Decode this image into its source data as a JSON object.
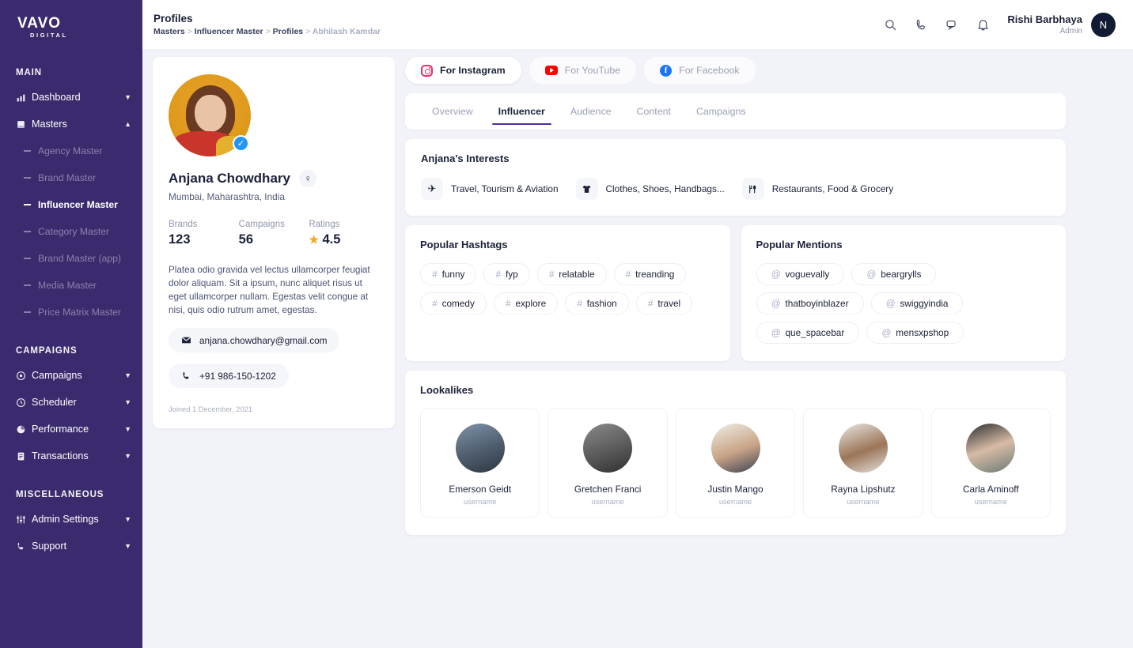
{
  "sidebar": {
    "logo": {
      "main": "VAVO",
      "sub": "DIGITAL"
    },
    "sections": [
      {
        "label": "MAIN",
        "items": [
          {
            "label": "Dashboard",
            "icon": "chart-bar-icon",
            "chevron": "chevron-down-icon"
          },
          {
            "label": "Masters",
            "icon": "book-icon",
            "chevron": "chevron-up-icon",
            "children": [
              {
                "label": "Agency Master",
                "active": false
              },
              {
                "label": "Brand Master",
                "active": false
              },
              {
                "label": "Influencer Master",
                "active": true
              },
              {
                "label": "Category Master",
                "active": false
              },
              {
                "label": "Brand Master (app)",
                "active": false
              },
              {
                "label": "Media Master",
                "active": false
              },
              {
                "label": "Price Matrix Master",
                "active": false
              }
            ]
          }
        ]
      },
      {
        "label": "CAMPAIGNS",
        "items": [
          {
            "label": "Campaigns",
            "icon": "target-icon",
            "chevron": "chevron-down-icon"
          },
          {
            "label": "Scheduler",
            "icon": "history-icon",
            "chevron": "chevron-down-icon"
          },
          {
            "label": "Performance",
            "icon": "pie-chart-icon",
            "chevron": "chevron-down-icon"
          },
          {
            "label": "Transactions",
            "icon": "receipt-icon",
            "chevron": "chevron-down-icon"
          }
        ]
      },
      {
        "label": "MISCELLANEOUS",
        "items": [
          {
            "label": "Admin Settings",
            "icon": "sliders-icon",
            "chevron": "chevron-down-icon"
          },
          {
            "label": "Support",
            "icon": "phone-icon",
            "chevron": "chevron-down-icon"
          }
        ]
      }
    ]
  },
  "topbar": {
    "title": "Profiles",
    "breadcrumb": [
      "Masters",
      "Influencer Master",
      "Profiles",
      "Abhilash Kamdar"
    ],
    "icons": [
      "search-icon",
      "phone-icon",
      "chat-icon",
      "bell-icon"
    ],
    "user": {
      "name": "Rishi Barbhaya",
      "role": "Admin",
      "initial": "N"
    }
  },
  "profile": {
    "name": "Anjana Chowdhary",
    "gender_symbol": "♀",
    "location": "Mumbai, Maharashtra, India",
    "verified": true,
    "stats": [
      {
        "label": "Brands",
        "value": "123"
      },
      {
        "label": "Campaigns",
        "value": "56"
      },
      {
        "label": "Ratings",
        "value": "4.5",
        "star": "★"
      }
    ],
    "bio": "Platea odio gravida vel lectus ullamcorper feugiat dolor aliquam. Sit a ipsum, nunc aliquet risus ut eget ullamcorper nullam. Egestas velit congue at nisi, quis odio rutrum amet, egestas.",
    "email": "anjana.chowdhary@gmail.com",
    "phone": "+91 986-150-1202",
    "joined": "Joined 1 December, 2021"
  },
  "platforms": [
    {
      "label": "For Instagram",
      "icon": "instagram-icon",
      "active": true
    },
    {
      "label": "For YouTube",
      "icon": "youtube-icon",
      "active": false
    },
    {
      "label": "For Facebook",
      "icon": "facebook-icon",
      "active": false
    }
  ],
  "tabs": [
    {
      "label": "Overview",
      "active": false
    },
    {
      "label": "Influencer",
      "active": true
    },
    {
      "label": "Audience",
      "active": false
    },
    {
      "label": "Content",
      "active": false
    },
    {
      "label": "Campaigns",
      "active": false
    }
  ],
  "interests": {
    "title": "Anjana's Interests",
    "items": [
      {
        "label": "Travel, Tourism & Aviation",
        "icon": "airplane-icon",
        "glyph": "✈"
      },
      {
        "label": "Clothes, Shoes, Handbags...",
        "icon": "tshirt-icon",
        "glyph": "Ƙ"
      },
      {
        "label": "Restaurants, Food & Grocery",
        "icon": "cutlery-icon",
        "glyph": "🍴"
      }
    ]
  },
  "hashtags": {
    "title": "Popular Hashtags",
    "symbol": "#",
    "items": [
      "funny",
      "fyp",
      "relatable",
      "treanding",
      "comedy",
      "explore",
      "fashion",
      "travel"
    ]
  },
  "mentions": {
    "title": "Popular Mentions",
    "symbol": "@",
    "items": [
      "voguevally",
      "beargrylls",
      "thatboyinblazer",
      "swiggyindia",
      "que_spacebar",
      "mensxpshop"
    ]
  },
  "lookalikes": {
    "title": "Lookalikes",
    "items": [
      {
        "name": "Emerson Geidt",
        "username": "username"
      },
      {
        "name": "Gretchen Franci",
        "username": "username"
      },
      {
        "name": "Justin Mango",
        "username": "username"
      },
      {
        "name": "Rayna Lipshutz",
        "username": "username"
      },
      {
        "name": "Carla Aminoff",
        "username": "username"
      }
    ]
  },
  "colors": {
    "sidebar": "#3B2B6E",
    "background": "#F2F3F8",
    "accent": "#4A2FA8",
    "instagram": "#E1306C",
    "youtube": "#FF0000",
    "facebook": "#1877F2",
    "star": "#F5A623",
    "verified": "#2196F3"
  }
}
